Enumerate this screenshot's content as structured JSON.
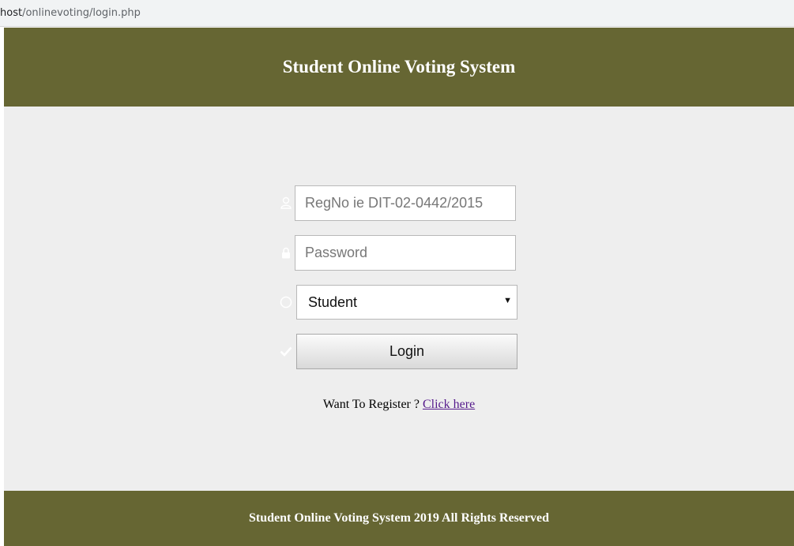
{
  "browser": {
    "url_host": "host",
    "url_path": "/onlinevoting/login.php"
  },
  "header": {
    "title": "Student Online Voting System"
  },
  "login_form": {
    "regno_placeholder": "RegNo ie DIT-02-0442/2015",
    "password_placeholder": "Password",
    "role_selected": "Student",
    "login_label": "Login",
    "icons": [
      "user-icon",
      "lock-icon",
      "circle-icon",
      "check-icon"
    ]
  },
  "register": {
    "prompt": "Want To Register ?",
    "link_text": "Click here"
  },
  "footer": {
    "text": "Student Online Voting System 2019 All Rights Reserved"
  },
  "colors": {
    "banner": "#666633",
    "content_bg": "#eeeeee",
    "link": "#551a8b"
  }
}
